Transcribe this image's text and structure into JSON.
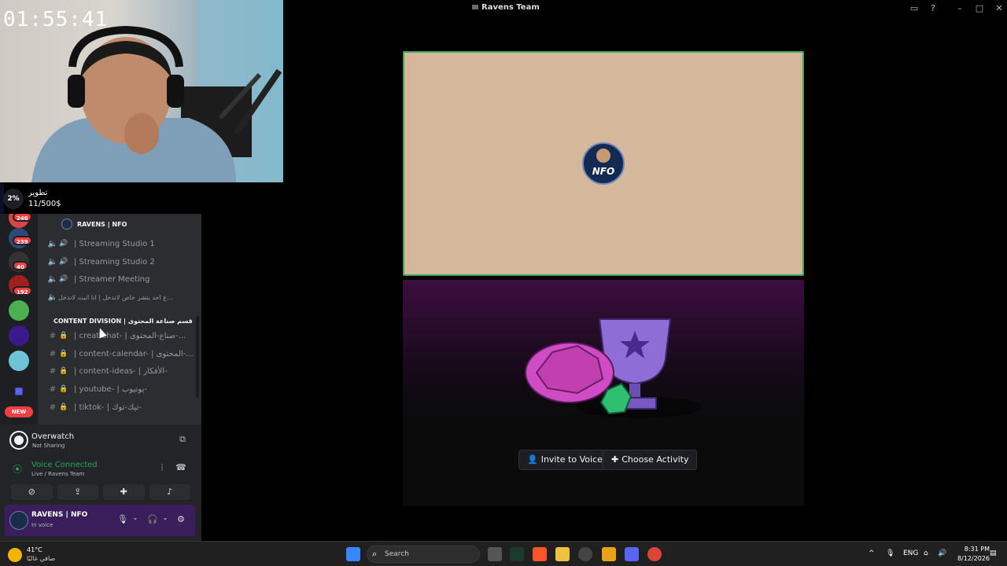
{
  "window": {
    "title": "Ravens Team"
  },
  "stream": {
    "timer": "01:55:41"
  },
  "goal": {
    "percent": "2%",
    "title": "تطوير",
    "amount": "11/500$",
    "progress": 0.02
  },
  "server_rail": {
    "badges": [
      "246",
      "239",
      "40",
      "192"
    ],
    "new_label": "NEW"
  },
  "channels": {
    "server_name": "RAVENS | NFO",
    "voice": [
      {
        "label": "| Streaming Studio 1"
      },
      {
        "label": "| Streaming Studio 2"
      },
      {
        "label": "| Streamer Meeting"
      },
      {
        "label": "ع احد يتشر خاص لاتدخل | انا اتيت لاتدخل..."
      }
    ],
    "category": "CONTENT DIVISION | قسم صناعة المحتوى",
    "text": [
      {
        "label": "| creat-chat- | صناع-المحتوى-..."
      },
      {
        "label": "| content-calendar- | المحتوى-..."
      },
      {
        "label": "| content-ideas- | الأفكار-"
      },
      {
        "label": "| youtube- | يوتيوب-"
      },
      {
        "label": "| tiktok- | تيك-توك-"
      }
    ]
  },
  "activity": {
    "game": "Overwatch",
    "status": "Not Sharing"
  },
  "voice": {
    "title": "Voice Connected",
    "subtitle": "Live / Ravens Team"
  },
  "user": {
    "name": "RAVENS | NFO",
    "status": "In voice"
  },
  "stage": {
    "logo_text": "NFO",
    "invite_label": "Invite to Voice",
    "activity_label": "Choose Activity"
  },
  "taskbar": {
    "temp": "41°C",
    "condition": "صافي غالبًا",
    "search": "Search",
    "lang": "ENG",
    "time": "8:31 PM",
    "date": "8/12/2026"
  },
  "colors": {
    "accent": "#5865f2",
    "voice_green": "#23a55a",
    "stage_bg": "#d5b89c"
  }
}
